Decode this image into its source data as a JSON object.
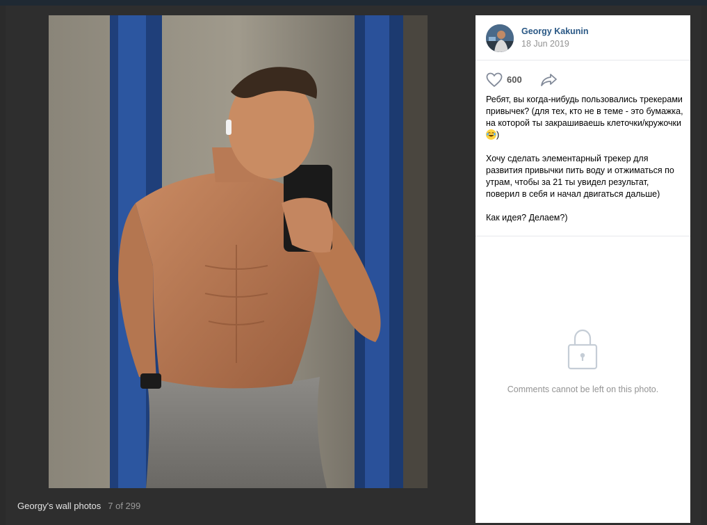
{
  "viewer": {
    "album_title": "Georgy's wall photos",
    "counter": "7 of 299"
  },
  "author": {
    "name": "Georgy Kakunin",
    "date": "18 Jun 2019"
  },
  "actions": {
    "likes": "600",
    "like_icon": "heart-icon",
    "share_icon": "share-arrow-icon"
  },
  "description": {
    "p1": "Ребят, вы когда-нибудь пользовались трекерами привычек? (для тех, кто не в теме - это бумажка, на которой ты закрашиваешь клеточки/кружочки",
    "p1_end": ")",
    "p2": "Хочу сделать элементарный трекер для развития привычки пить воду и отжиматься по утрам, чтобы за 21 ты увидел результат, поверил в себя и начал двигаться дальше)",
    "p3": "Как идея? Делаем?)"
  },
  "comments": {
    "disabled_text": "Comments cannot be left on this photo.",
    "icon": "lock-icon"
  },
  "colors": {
    "link": "#2a5885",
    "muted": "#939393",
    "viewer_bg": "#2e2e2e"
  }
}
